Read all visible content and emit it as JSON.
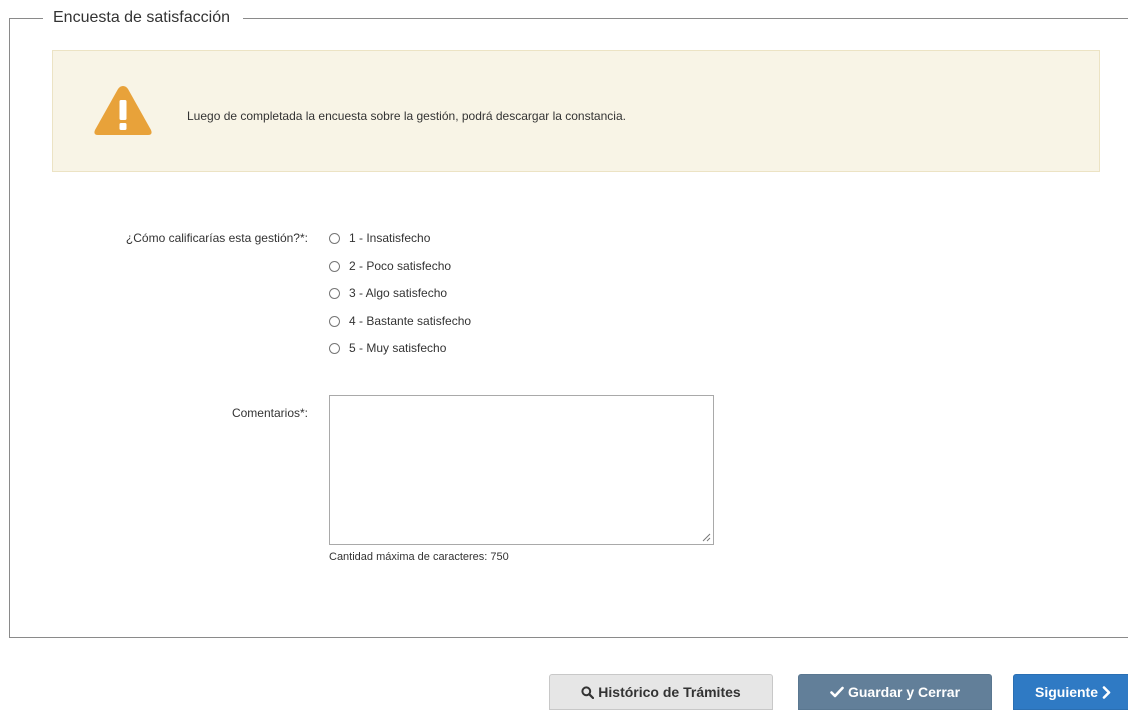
{
  "survey": {
    "legend": "Encuesta de satisfacción"
  },
  "warning": {
    "icon": "warning-triangle-icon",
    "icon_color": "#e8a23a",
    "background": "#f8f4e6",
    "text": "Luego de completada la encuesta sobre la gestión, podrá descargar la constancia."
  },
  "rating": {
    "label": "¿Cómo calificarías esta gestión?*:",
    "options": [
      {
        "label": "1 - Insatisfecho",
        "selected": false
      },
      {
        "label": "2 - Poco satisfecho",
        "selected": false
      },
      {
        "label": "3 - Algo satisfecho",
        "selected": false
      },
      {
        "label": "4 - Bastante satisfecho",
        "selected": false
      },
      {
        "label": "5 - Muy satisfecho",
        "selected": false
      }
    ]
  },
  "comments": {
    "label": "Comentarios*:",
    "value": "",
    "hint": "Cantidad máxima de caracteres: 750"
  },
  "buttons": {
    "history": {
      "label": "Histórico de Trámites",
      "icon": "search-icon"
    },
    "save": {
      "label": "Guardar y Cerrar",
      "icon": "check-icon",
      "color": "#627f99"
    },
    "next": {
      "label": "Siguiente",
      "icon": "chevron-right-icon",
      "color": "#2f7ac4"
    }
  }
}
